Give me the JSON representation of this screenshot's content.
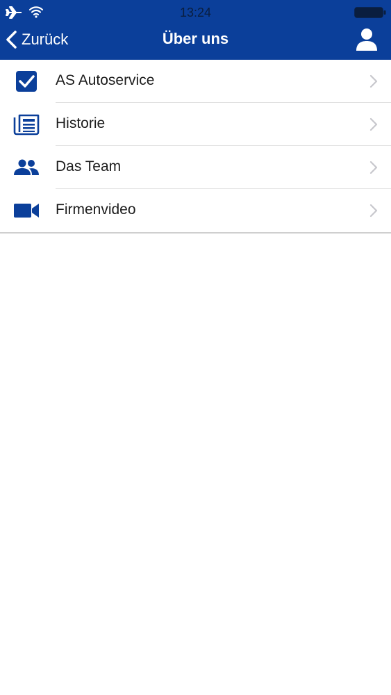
{
  "status_bar": {
    "time": "13:24",
    "icons": [
      "airplane-icon",
      "wifi-icon",
      "battery-icon"
    ]
  },
  "nav": {
    "back_label": "Zurück",
    "title": "Über uns",
    "right_icon": "user-icon"
  },
  "colors": {
    "brand": "#0b3f9a",
    "separator": "#e0e0e0",
    "chevron": "#c7c7cc"
  },
  "menu": [
    {
      "label": "AS Autoservice",
      "icon": "checkbox-icon"
    },
    {
      "label": "Historie",
      "icon": "newspaper-icon"
    },
    {
      "label": "Das Team",
      "icon": "people-icon"
    },
    {
      "label": "Firmenvideo",
      "icon": "video-camera-icon"
    }
  ]
}
